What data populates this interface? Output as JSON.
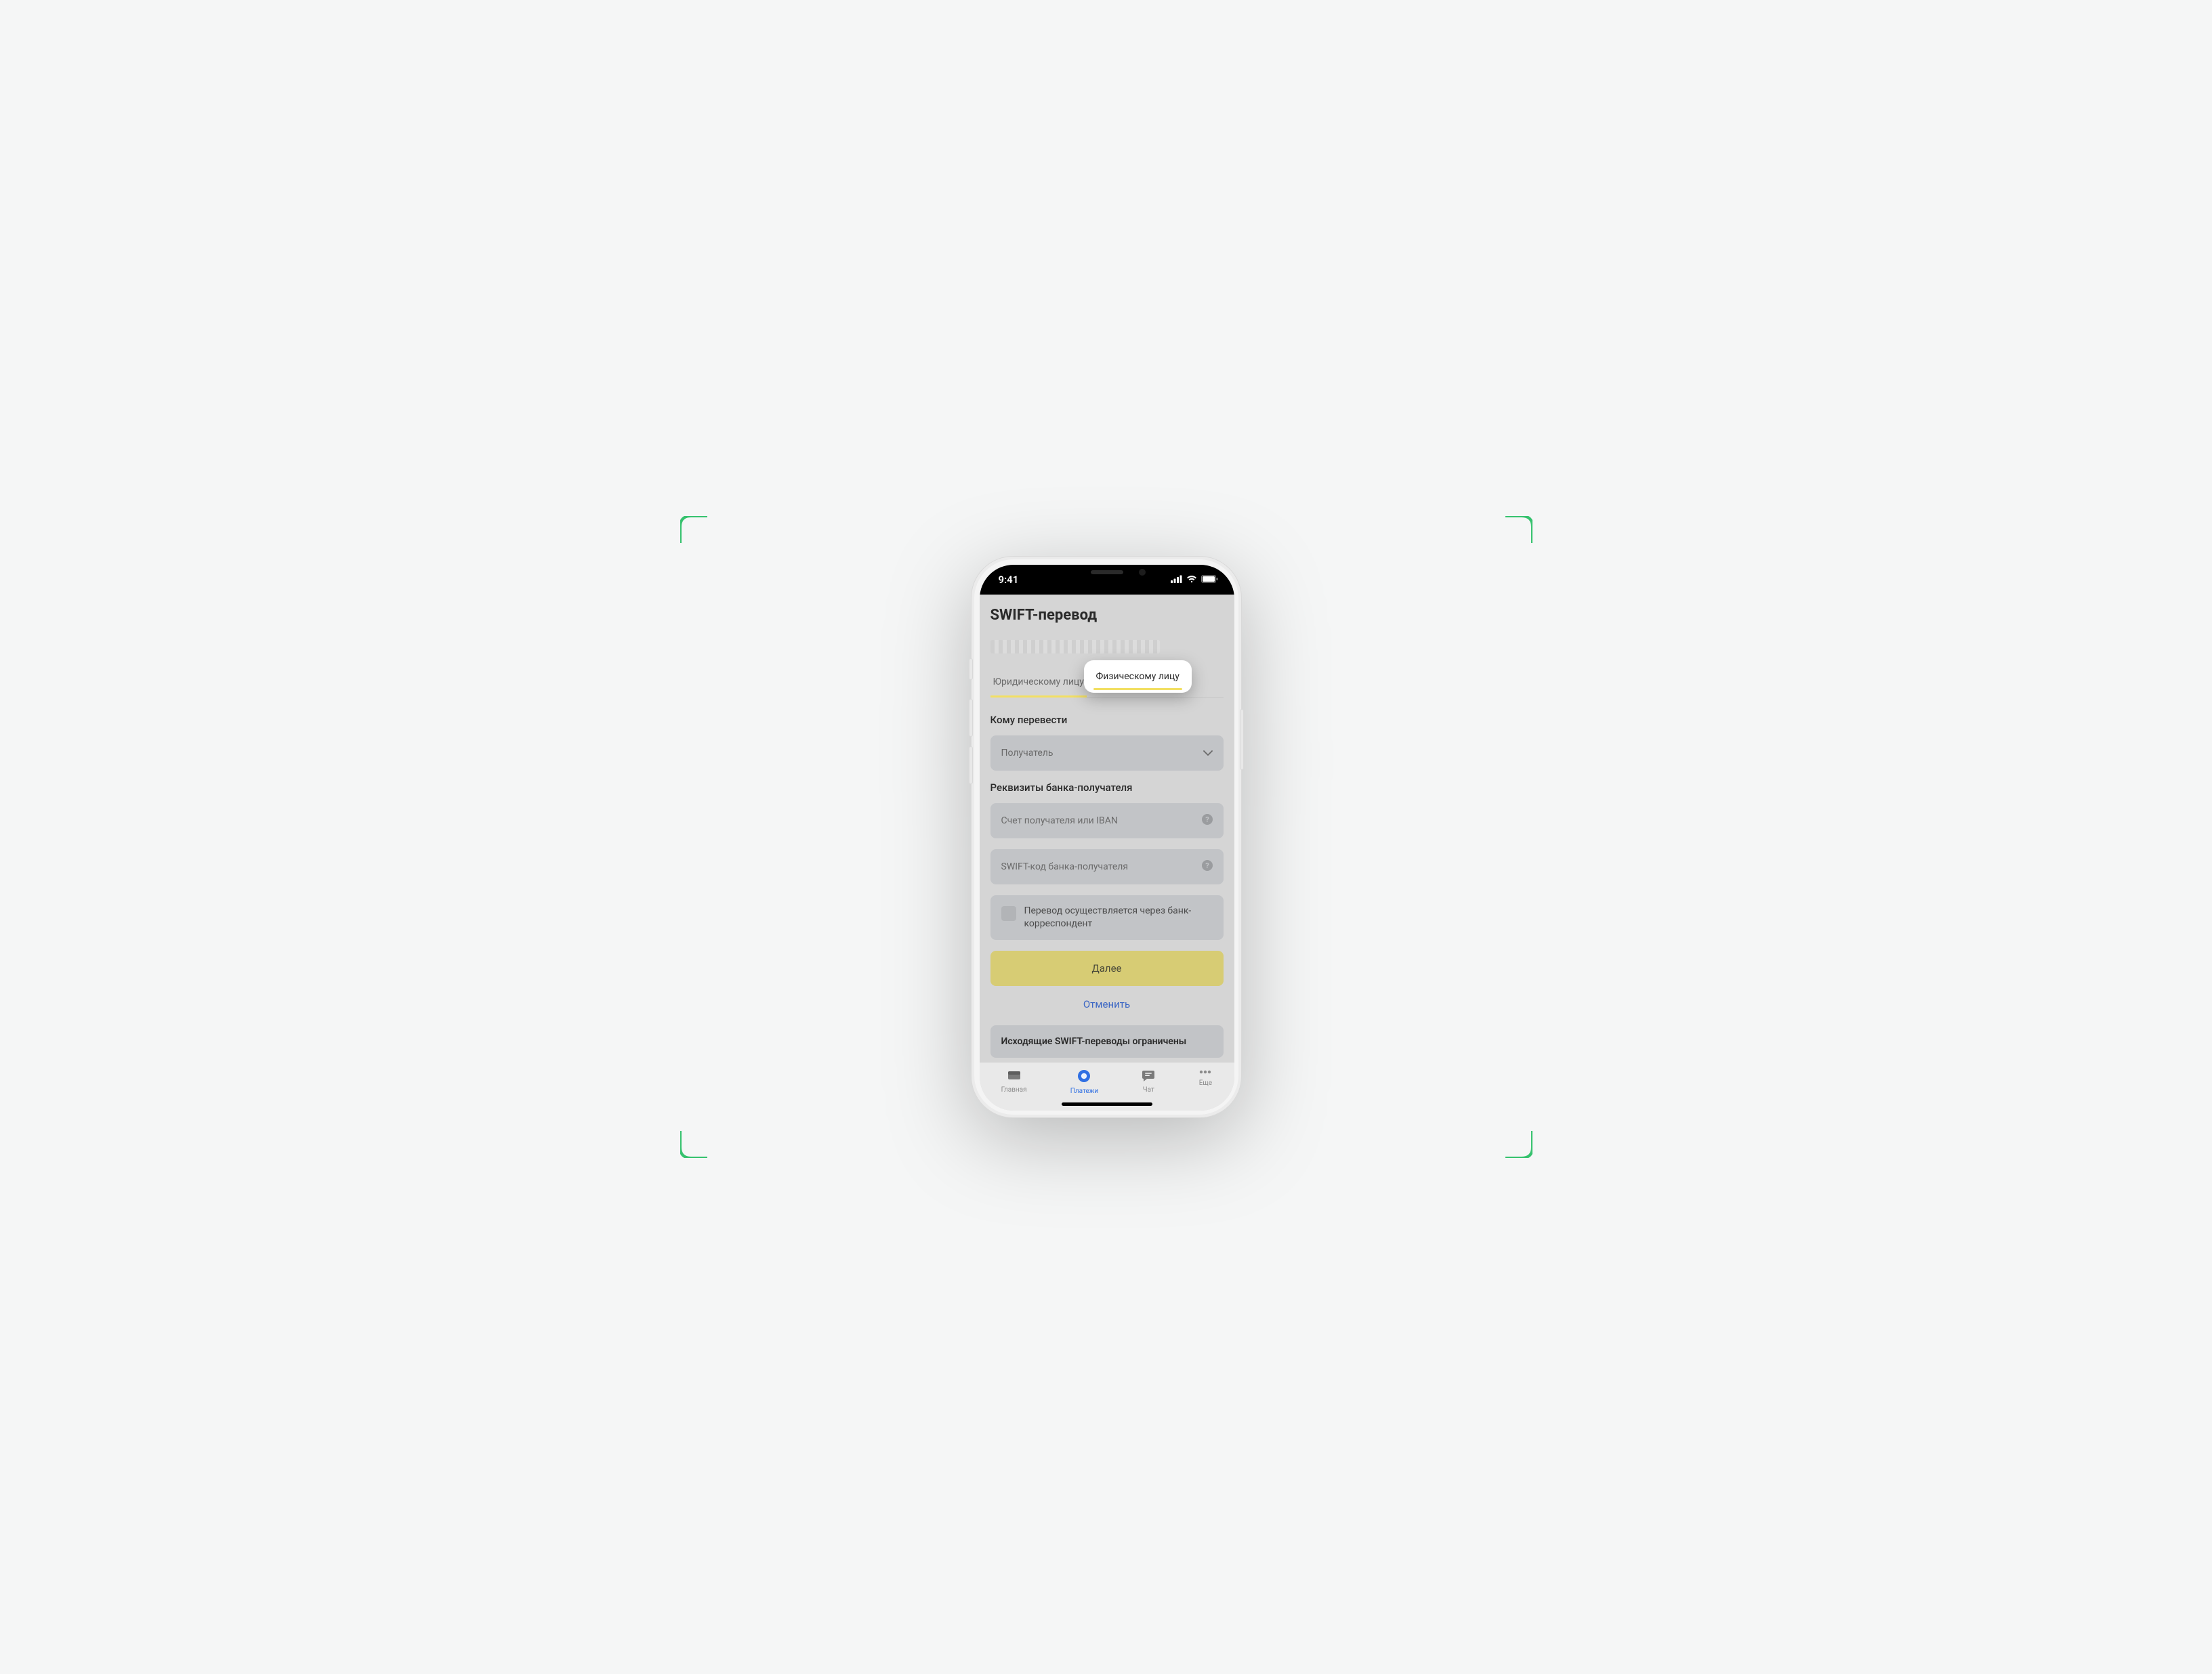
{
  "status": {
    "time": "9:41"
  },
  "title": "SWIFT-перевод",
  "tabs": {
    "legal": "Юридическому лицу",
    "individual": "Физическому лицу"
  },
  "section_to": {
    "label": "Кому перевести",
    "recipient_placeholder": "Получатель"
  },
  "section_bank": {
    "label": "Реквизиты банка-получателя",
    "account_placeholder": "Счет получателя или IBAN",
    "swift_placeholder": "SWIFT-код банка-получателя"
  },
  "correspondent_checkbox": "Перевод осуществляется через банк-корреспондент",
  "buttons": {
    "next": "Далее",
    "cancel": "Отменить"
  },
  "notice": "Исходящие SWIFT-переводы ограничены",
  "tabbar": {
    "home": "Главная",
    "payments": "Платежи",
    "chat": "Чат",
    "more": "Еще"
  },
  "colors": {
    "accent_yellow": "#d7cc74",
    "tab_underline": "#f2df63",
    "link_blue": "#3b66c4",
    "active_blue": "#2f6fe3"
  }
}
